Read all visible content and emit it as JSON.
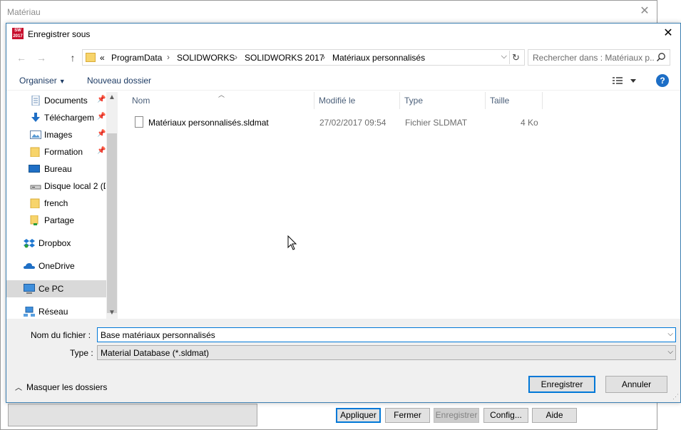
{
  "background_window": {
    "title": "Matériau",
    "buttons": [
      "Appliquer",
      "Fermer",
      "Enregistrer",
      "Config...",
      "Aide"
    ]
  },
  "dialog": {
    "title": "Enregistrer sous",
    "app_icon_text": "SW 2017",
    "close_glyph": "✕"
  },
  "navigation": {
    "back_glyph": "←",
    "forward_glyph": "→",
    "up_glyph": "↑",
    "breadcrumb_overflow": "«",
    "breadcrumb": [
      "ProgramData",
      "SOLIDWORKS",
      "SOLIDWORKS 2017",
      "Matériaux personnalisés"
    ],
    "search_placeholder": "Rechercher dans : Matériaux p..."
  },
  "toolbar": {
    "organise_label": "Organiser",
    "new_folder_label": "Nouveau dossier",
    "help_label": "?"
  },
  "sidebar": {
    "items": [
      {
        "label": "Documents",
        "icon": "documents-icon",
        "pinned": true
      },
      {
        "label": "Téléchargem",
        "icon": "downloads-icon",
        "pinned": true
      },
      {
        "label": "Images",
        "icon": "images-icon",
        "pinned": true
      },
      {
        "label": "Formation",
        "icon": "folder-icon",
        "pinned": true
      },
      {
        "label": "Bureau",
        "icon": "desktop-icon",
        "pinned": false
      },
      {
        "label": "Disque local 2 (D",
        "icon": "drive-icon",
        "pinned": false
      },
      {
        "label": "french",
        "icon": "folder-icon",
        "pinned": false
      },
      {
        "label": "Partage",
        "icon": "shared-folder-icon",
        "pinned": false
      },
      {
        "label": "Dropbox",
        "icon": "dropbox-icon",
        "pinned": false
      },
      {
        "label": "OneDrive",
        "icon": "onedrive-icon",
        "pinned": false
      },
      {
        "label": "Ce PC",
        "icon": "computer-icon",
        "pinned": false,
        "selected": true
      },
      {
        "label": "Réseau",
        "icon": "network-icon",
        "pinned": false
      }
    ]
  },
  "file_list": {
    "columns": [
      "Nom",
      "Modifié le",
      "Type",
      "Taille"
    ],
    "rows": [
      {
        "name": "Matériaux personnalisés.sldmat",
        "modified": "27/02/2017 09:54",
        "type": "Fichier SLDMAT",
        "size": "4 Ko"
      }
    ]
  },
  "form": {
    "filename_label": "Nom du fichier :",
    "filename_value": "Base matériaux personnalisés",
    "type_label": "Type :",
    "type_value": "Material Database (*.sldmat)",
    "hide_folders_label": "Masquer les dossiers",
    "save_label": "Enregistrer",
    "cancel_label": "Annuler"
  },
  "colors": {
    "accent": "#0078d7",
    "link": "#1e3c65",
    "folder": "#f7d46b",
    "selection": "#d9d9d9",
    "help": "#1d6ec6"
  }
}
